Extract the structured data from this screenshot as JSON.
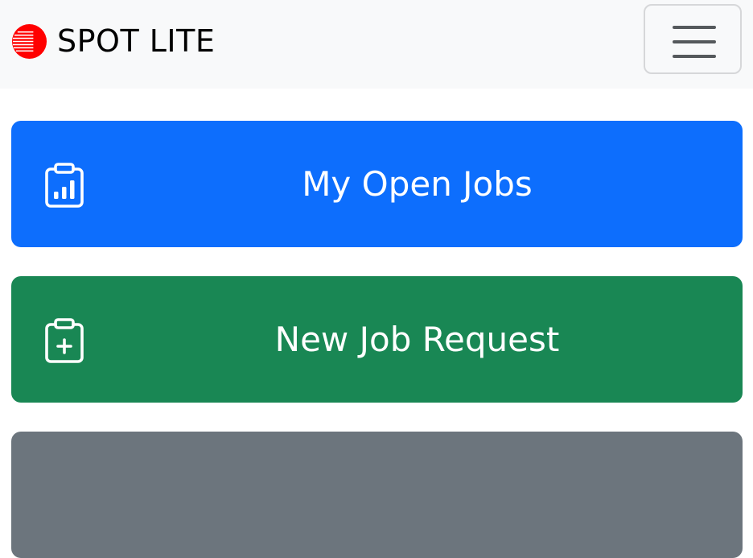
{
  "navbar": {
    "brand_text": "SPOT LITE",
    "logo_icon": "spot-logo-icon",
    "logo_color": "#ff0000",
    "menu_icon": "hamburger-menu-icon",
    "background": "#f8f9fa"
  },
  "tiles": [
    {
      "label": "My Open Jobs",
      "icon": "clipboard-data-icon",
      "color": "#0d6efd"
    },
    {
      "label": "New Job Request",
      "icon": "clipboard-plus-icon",
      "color": "#198754"
    },
    {
      "label": "",
      "icon": "",
      "color": "#6c757d"
    }
  ]
}
